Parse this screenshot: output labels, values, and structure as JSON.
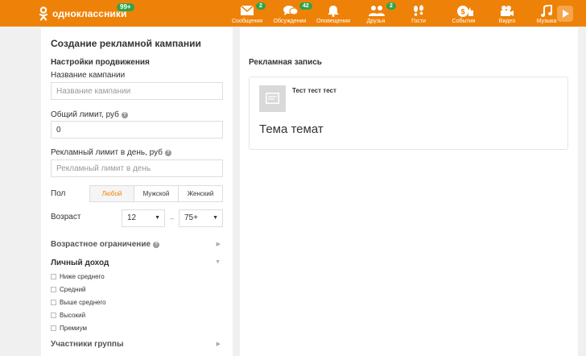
{
  "header": {
    "logo_text": "одноклассники",
    "logo_badge": "99+",
    "nav": [
      {
        "label": "Сообщения",
        "icon": "envelope-icon",
        "badge": "2"
      },
      {
        "label": "Обсуждения",
        "icon": "chat-bubbles-icon",
        "badge": "42"
      },
      {
        "label": "Оповещения",
        "icon": "bell-icon",
        "badge": ""
      },
      {
        "label": "Друзья",
        "icon": "friends-icon",
        "badge": "2"
      },
      {
        "label": "Гости",
        "icon": "footprints-icon",
        "badge": ""
      },
      {
        "label": "События",
        "icon": "events-icon",
        "badge": ""
      },
      {
        "label": "Видео",
        "icon": "video-camera-icon",
        "badge": ""
      },
      {
        "label": "Музыка",
        "icon": "music-note-icon",
        "badge": ""
      }
    ],
    "accent_color": "#ee8208",
    "badge_color": "#2ea44b"
  },
  "form": {
    "page_title": "Создание рекламной кампании",
    "section_title": "Настройки продвижения",
    "campaign_name_label": "Название кампании",
    "campaign_name_placeholder": "Название кампании",
    "campaign_name_value": "",
    "total_limit_label": "Общий лимит, руб",
    "total_limit_value": "0",
    "daily_limit_label": "Рекламный лимит в день, руб",
    "daily_limit_placeholder": "Рекламный лимит в день",
    "gender_label": "Пол",
    "gender_options": [
      "Любой",
      "Мужской",
      "Женский"
    ],
    "gender_selected": "Любой",
    "age_label": "Возраст",
    "age_from": "12",
    "age_to": "75+",
    "age_separator": "–",
    "age_restriction_label": "Возрастное ограничение",
    "income_label": "Личный доход",
    "income_options": [
      "Ниже среднего",
      "Средний",
      "Выше среднего",
      "Высокий",
      "Премиум"
    ],
    "group_members_label": "Участники группы"
  },
  "preview": {
    "section_title": "Рекламная запись",
    "ad_title": "Тест тест тест",
    "ad_text": "Тема темат"
  }
}
